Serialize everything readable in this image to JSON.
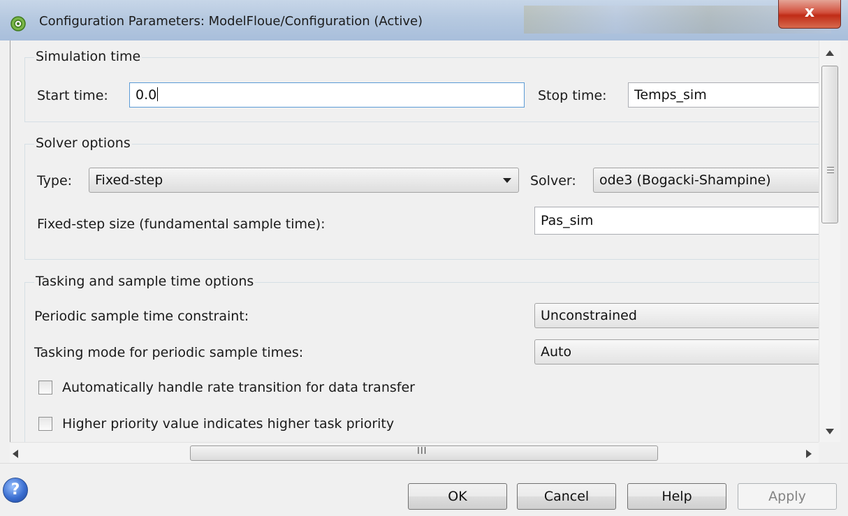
{
  "window": {
    "title": "Configuration Parameters: ModelFloue/Configuration (Active)",
    "close_label": "x"
  },
  "simulation_time": {
    "legend": "Simulation time",
    "start_label": "Start time:",
    "start_value": "0.0",
    "stop_label": "Stop time:",
    "stop_value": "Temps_sim"
  },
  "solver_options": {
    "legend": "Solver options",
    "type_label": "Type:",
    "type_value": "Fixed-step",
    "solver_label": "Solver:",
    "solver_value": "ode3 (Bogacki-Shampine)",
    "step_label": "Fixed-step size (fundamental sample time):",
    "step_value": "Pas_sim"
  },
  "tasking": {
    "legend": "Tasking and sample time options",
    "periodic_label": "Periodic sample time constraint:",
    "periodic_value": "Unconstrained",
    "mode_label": "Tasking mode for periodic sample times:",
    "mode_value": "Auto",
    "checkboxes": [
      {
        "label": "Automatically handle rate transition for data transfer",
        "checked": false
      },
      {
        "label": "Higher priority value indicates higher task priority",
        "checked": false
      }
    ]
  },
  "scrollbar": {
    "grip": "III"
  },
  "buttons": {
    "help_icon": "?",
    "ok": "OK",
    "cancel": "Cancel",
    "help": "Help",
    "apply": "Apply"
  },
  "colors": {
    "close_red": "#c02c16",
    "focus_blue": "#5b9bd5",
    "titlebar": "#b6c9e0"
  }
}
